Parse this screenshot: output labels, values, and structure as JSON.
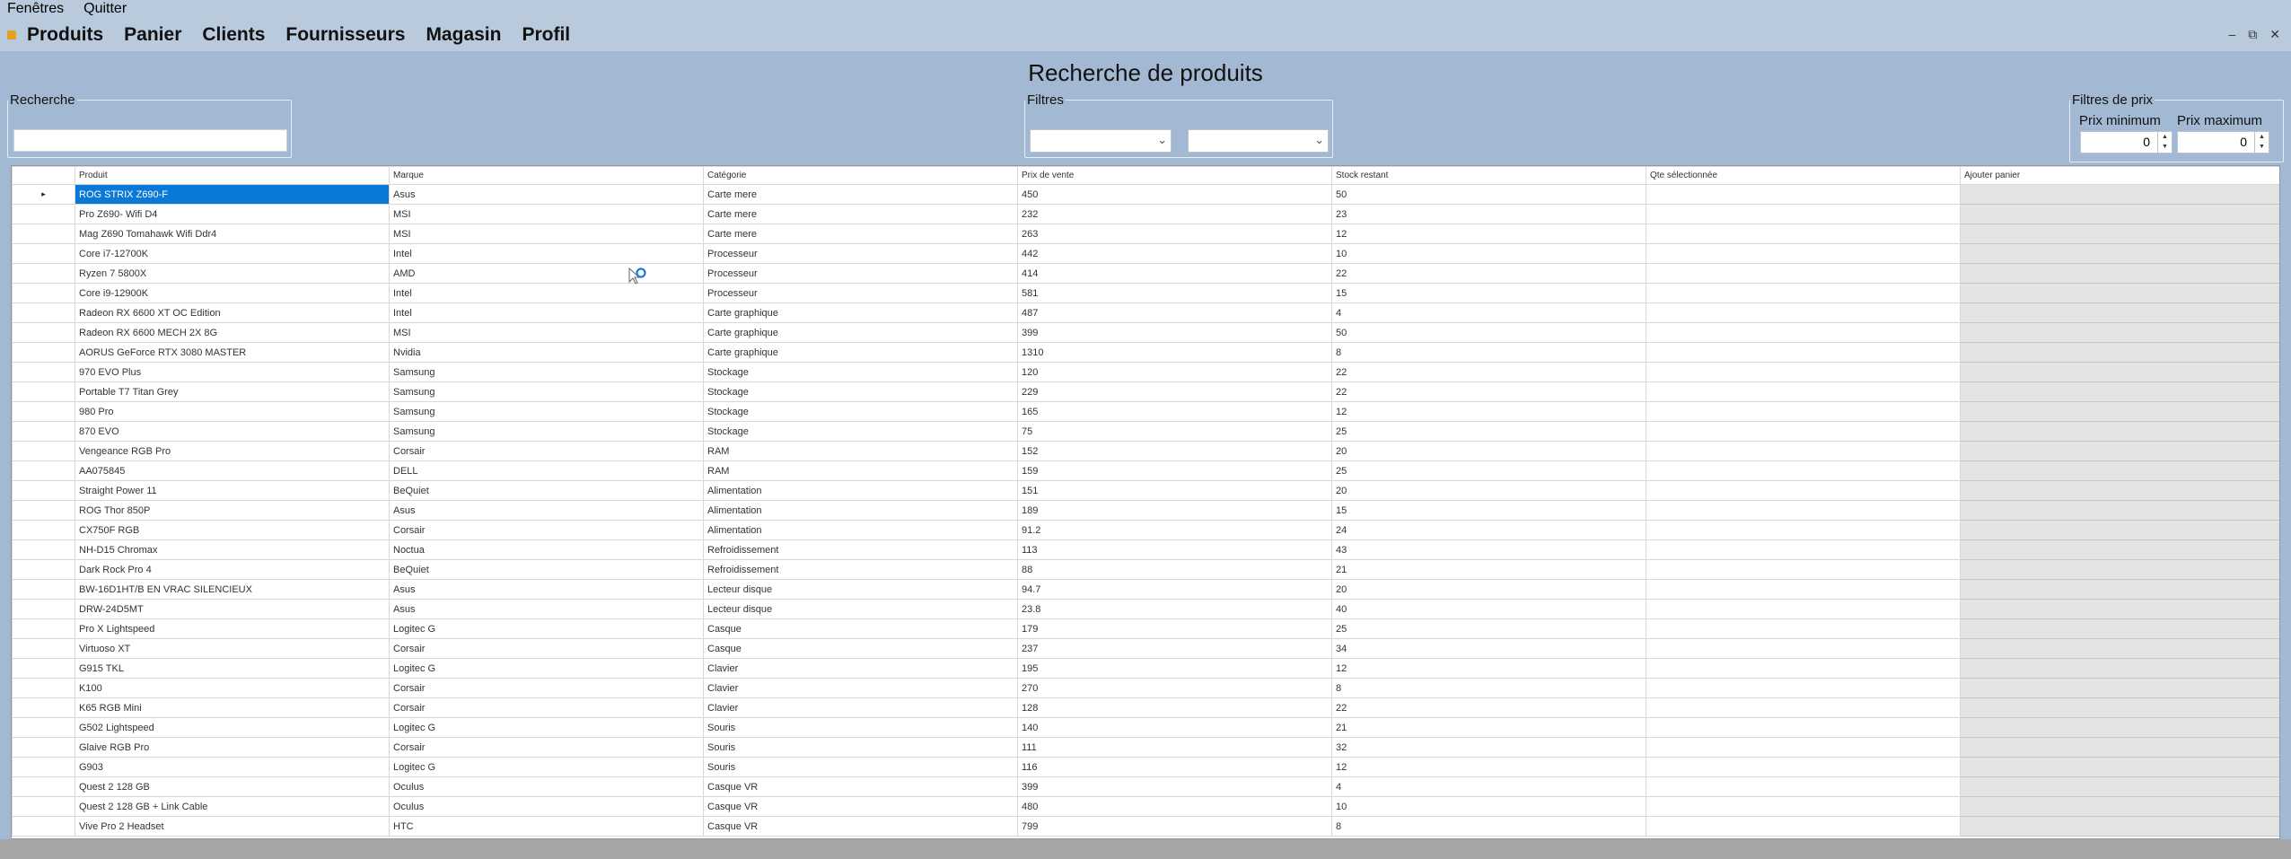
{
  "sysmenu": [
    "Fenêtres",
    "Quitter"
  ],
  "menu": [
    "Produits",
    "Panier",
    "Clients",
    "Fournisseurs",
    "Magasin",
    "Profil"
  ],
  "window_controls": [
    "–",
    "⧉",
    "✕"
  ],
  "title": "Recherche de produits",
  "search": {
    "legend": "Recherche",
    "value": ""
  },
  "filters": {
    "legend": "Filtres",
    "combo1": "",
    "combo2": ""
  },
  "price_filters": {
    "legend": "Filtres de prix",
    "min_label": "Prix minimum",
    "max_label": "Prix maximum",
    "min_value": "0",
    "max_value": "0"
  },
  "grid": {
    "columns": [
      "Produit",
      "Marque",
      "Catégorie",
      "Prix de vente",
      "Stock restant",
      "Qte sélectionnée",
      "Ajouter panier"
    ],
    "selected_row": 0,
    "rows": [
      [
        "ROG STRIX Z690-F",
        "Asus",
        "Carte mere",
        "450",
        "50",
        "",
        ""
      ],
      [
        "Pro Z690- Wifi D4",
        "MSI",
        "Carte mere",
        "232",
        "23",
        "",
        ""
      ],
      [
        "Mag Z690 Tomahawk Wifi Ddr4",
        "MSI",
        "Carte mere",
        "263",
        "12",
        "",
        ""
      ],
      [
        "Core i7-12700K",
        "Intel",
        "Processeur",
        "442",
        "10",
        "",
        ""
      ],
      [
        "Ryzen 7 5800X",
        "AMD",
        "Processeur",
        "414",
        "22",
        "",
        ""
      ],
      [
        "Core i9-12900K",
        "Intel",
        "Processeur",
        "581",
        "15",
        "",
        ""
      ],
      [
        "Radeon RX 6600 XT OC Edition",
        "Intel",
        "Carte graphique",
        "487",
        "4",
        "",
        ""
      ],
      [
        "Radeon RX 6600 MECH 2X 8G",
        "MSI",
        "Carte graphique",
        "399",
        "50",
        "",
        ""
      ],
      [
        "AORUS GeForce RTX 3080 MASTER",
        "Nvidia",
        "Carte graphique",
        "1310",
        "8",
        "",
        ""
      ],
      [
        "970 EVO Plus",
        "Samsung",
        "Stockage",
        "120",
        "22",
        "",
        ""
      ],
      [
        "Portable T7 Titan Grey",
        "Samsung",
        "Stockage",
        "229",
        "22",
        "",
        ""
      ],
      [
        "980 Pro",
        "Samsung",
        "Stockage",
        "165",
        "12",
        "",
        ""
      ],
      [
        "870 EVO",
        "Samsung",
        "Stockage",
        "75",
        "25",
        "",
        ""
      ],
      [
        "Vengeance RGB Pro",
        "Corsair",
        "RAM",
        "152",
        "20",
        "",
        ""
      ],
      [
        "AA075845",
        "DELL",
        "RAM",
        "159",
        "25",
        "",
        ""
      ],
      [
        "Straight Power 11",
        "BeQuiet",
        "Alimentation",
        "151",
        "20",
        "",
        ""
      ],
      [
        "ROG Thor 850P",
        "Asus",
        "Alimentation",
        "189",
        "15",
        "",
        ""
      ],
      [
        "CX750F RGB",
        "Corsair",
        "Alimentation",
        "91.2",
        "24",
        "",
        ""
      ],
      [
        "NH-D15 Chromax",
        "Noctua",
        "Refroidissement",
        "113",
        "43",
        "",
        ""
      ],
      [
        "Dark Rock Pro 4",
        "BeQuiet",
        "Refroidissement",
        "88",
        "21",
        "",
        ""
      ],
      [
        "BW-16D1HT/B EN VRAC SILENCIEUX",
        "Asus",
        "Lecteur disque",
        "94.7",
        "20",
        "",
        ""
      ],
      [
        "DRW-24D5MT",
        "Asus",
        "Lecteur disque",
        "23.8",
        "40",
        "",
        ""
      ],
      [
        "Pro X Lightspeed",
        "Logitec G",
        "Casque",
        "179",
        "25",
        "",
        ""
      ],
      [
        "Virtuoso XT",
        "Corsair",
        "Casque",
        "237",
        "34",
        "",
        ""
      ],
      [
        "G915 TKL",
        "Logitec G",
        "Clavier",
        "195",
        "12",
        "",
        ""
      ],
      [
        "K100",
        "Corsair",
        "Clavier",
        "270",
        "8",
        "",
        ""
      ],
      [
        "K65 RGB Mini",
        "Corsair",
        "Clavier",
        "128",
        "22",
        "",
        ""
      ],
      [
        "G502 Lightspeed",
        "Logitec G",
        "Souris",
        "140",
        "21",
        "",
        ""
      ],
      [
        "Glaive RGB Pro",
        "Corsair",
        "Souris",
        "111",
        "32",
        "",
        ""
      ],
      [
        "G903",
        "Logitec G",
        "Souris",
        "116",
        "12",
        "",
        ""
      ],
      [
        "Quest 2 128 GB",
        "Oculus",
        "Casque VR",
        "399",
        "4",
        "",
        ""
      ],
      [
        "Quest 2 128 GB + Link Cable",
        "Oculus",
        "Casque VR",
        "480",
        "10",
        "",
        ""
      ],
      [
        "Vive Pro 2 Headset",
        "HTC",
        "Casque VR",
        "799",
        "8",
        "",
        ""
      ]
    ]
  }
}
